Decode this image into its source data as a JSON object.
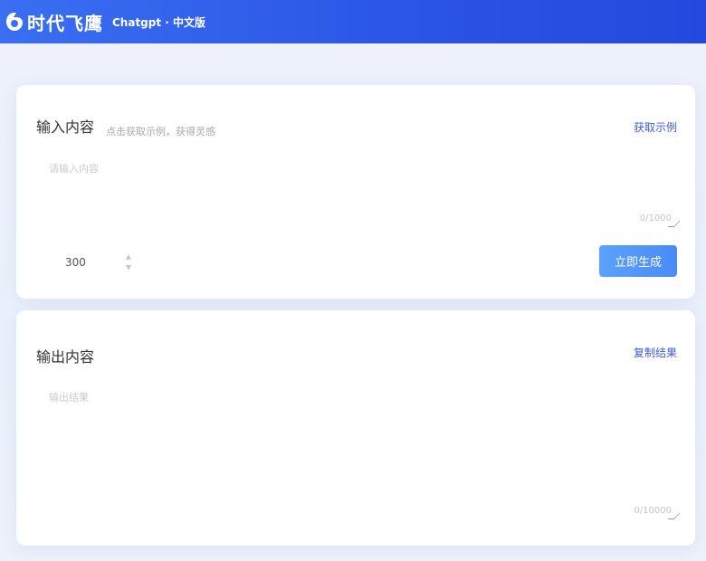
{
  "header": {
    "logo_text": "时代飞鹰",
    "product_name": "Chatgpt · 中文版"
  },
  "input_card": {
    "title": "输入内容",
    "hint": "点击获取示例，获得灵感",
    "example_link": "获取示例",
    "textarea_placeholder": "请输入内容",
    "counter": "0/1000",
    "length_value": "300",
    "generate_label": "立即生成"
  },
  "output_card": {
    "title": "输出内容",
    "copy_link": "复制结果",
    "textarea_placeholder": "输出结果",
    "counter": "0/10000"
  },
  "colors": {
    "header_start": "#3a6ff2",
    "header_end": "#2448dd",
    "link": "#3d5bd9",
    "button": "#4a8bf7"
  }
}
